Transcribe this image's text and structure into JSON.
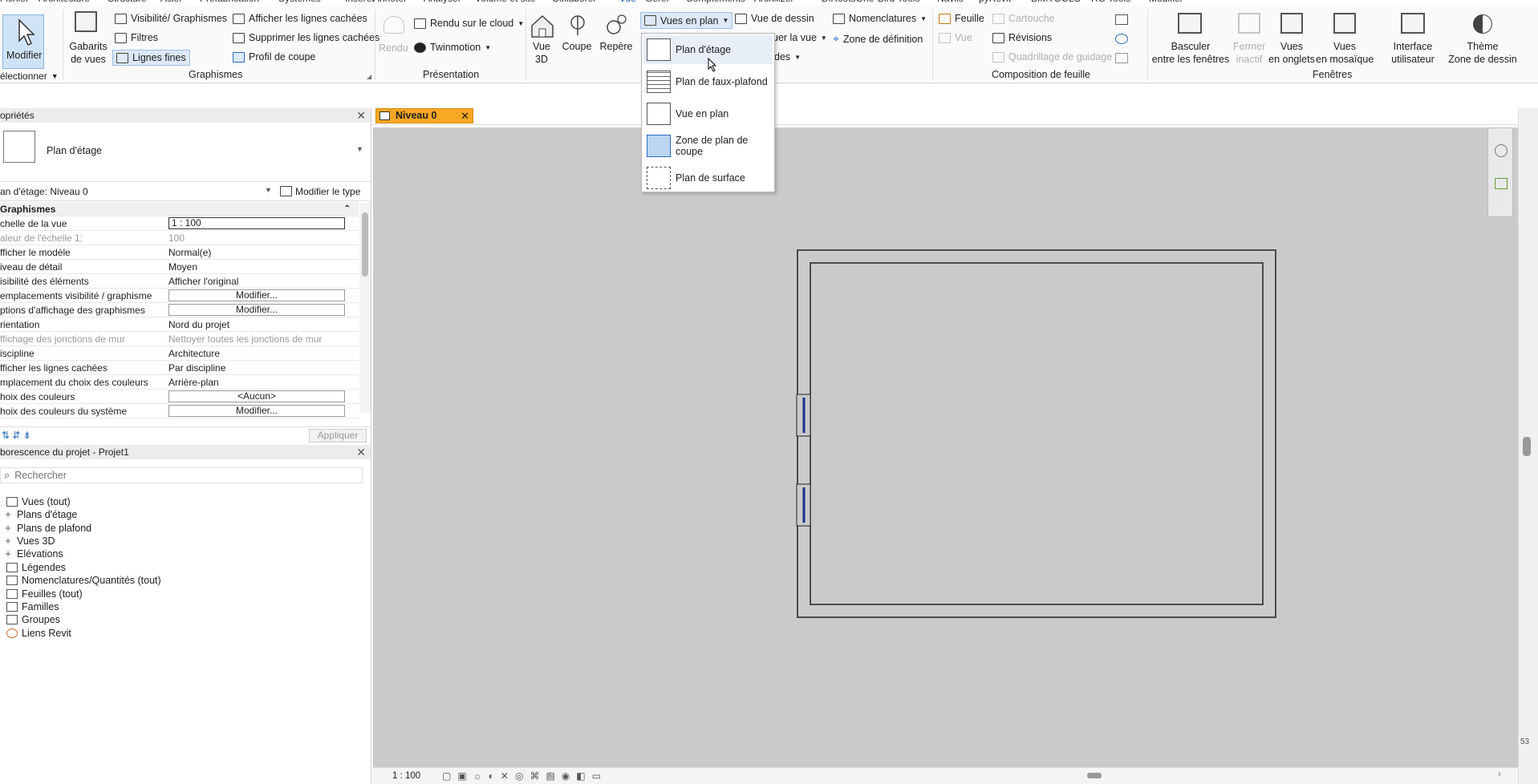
{
  "ribbon_tabs": [
    "Fichier",
    "Architecture",
    "Structure",
    "Acier",
    "Préfabrication",
    "Systèmes",
    "Insérer",
    "Annoter",
    "Analyser",
    "Volume et site",
    "Collaborer",
    "Vue",
    "Gérer",
    "Compléments",
    "Archilizer",
    "DiRootsOne",
    "Bird Tools",
    "Naviis",
    "pyRevit",
    "BIMTOOLS",
    "RG Tools",
    "Modifier"
  ],
  "active_tab": "Vue",
  "ribbon": {
    "modify": "Modifier",
    "select_label": "électionner",
    "view_templates": [
      "Gabarits",
      "de vues"
    ],
    "vis_graphics": "Visibilité/ Graphismes",
    "filters": "Filtres",
    "thin_lines": "Lignes fines",
    "show_hidden": "Afficher les lignes cachées",
    "remove_hidden": "Supprimer les lignes cachées",
    "cut_profile": "Profil de coupe",
    "group_graphics": "Graphismes",
    "render": "Rendu",
    "render_cloud": "Rendu sur le cloud",
    "twinmotion": "Twinmotion",
    "group_presentation": "Présentation",
    "view3d": [
      "Vue",
      "3D"
    ],
    "section": "Coupe",
    "callout": "Repère",
    "plan_views": "Vues en plan",
    "drafting_view": "Vue de dessin",
    "duplicate_partial": "uer la vue",
    "legends_partial": "des",
    "schedules": "Nomenclatures",
    "scope_box": "Zone de définition",
    "sheet": "Feuille",
    "title_block": "Cartouche",
    "view": "Vue",
    "revisions": "Révisions",
    "guide_grid": "Quadrillage de guidage",
    "group_sheet": "Composition de feuille",
    "switch_windows": [
      "Basculer",
      "entre les fenêtres"
    ],
    "close_inactive": [
      "Fermer",
      "inactif"
    ],
    "tab_views": [
      "Vues",
      "en onglets"
    ],
    "tile_views": [
      "Vues",
      "en mosaïque"
    ],
    "user_interface": [
      "Interface",
      "utilisateur"
    ],
    "theme": [
      "Thème",
      "Zone de dessin"
    ],
    "group_windows": "Fenêtres"
  },
  "plan_menu": {
    "items": [
      "Plan d'étage",
      "Plan de faux-plafond",
      "Vue en plan",
      "Zone de plan de coupe",
      "Plan de surface"
    ]
  },
  "properties": {
    "title": "opriétés",
    "type_name": "Plan d'étage",
    "instance_selector": "an d'étage: Niveau 0",
    "edit_type": "Modifier le type",
    "group": "Graphismes",
    "rows": [
      {
        "k": "chelle de la vue",
        "v": "1 : 100",
        "style": "cur"
      },
      {
        "k": "aleur de l'échelle    1:",
        "v": "100",
        "style": "gray"
      },
      {
        "k": "fficher le modèle",
        "v": "Normal(e)",
        "style": ""
      },
      {
        "k": "iveau de détail",
        "v": "Moyen",
        "style": ""
      },
      {
        "k": "isibilité des éléments",
        "v": "Afficher l'original",
        "style": ""
      },
      {
        "k": "emplacements visibilité / graphisme",
        "v": "Modifier...",
        "style": "box"
      },
      {
        "k": "ptions d'affichage des graphismes",
        "v": "Modifier...",
        "style": "box"
      },
      {
        "k": "rientation",
        "v": "Nord du projet",
        "style": ""
      },
      {
        "k": "ffichage des jonctions de mur",
        "v": "Nettoyer toutes les jonctions de mur",
        "style": "gray"
      },
      {
        "k": "iscipline",
        "v": "Architecture",
        "style": ""
      },
      {
        "k": "fficher les lignes cachées",
        "v": "Par discipline",
        "style": ""
      },
      {
        "k": "mplacement du choix des couleurs",
        "v": "Arrière-plan",
        "style": ""
      },
      {
        "k": "hoix des couleurs",
        "v": "<Aucun>",
        "style": "box"
      },
      {
        "k": "hoix des couleurs du système",
        "v": "Modifier...",
        "style": "box"
      }
    ],
    "apply": "Appliquer"
  },
  "browser": {
    "title": "borescence du projet - Projet1",
    "search_placeholder": "Rechercher",
    "items": [
      {
        "label": "Vues (tout)",
        "kind": "root"
      },
      {
        "label": "Plans d'étage",
        "kind": "plus"
      },
      {
        "label": "Plans de plafond",
        "kind": "plus"
      },
      {
        "label": "Vues 3D",
        "kind": "plus"
      },
      {
        "label": "Elévations",
        "kind": "plus"
      },
      {
        "label": "Légendes",
        "kind": "icon"
      },
      {
        "label": "Nomenclatures/Quantités (tout)",
        "kind": "icon"
      },
      {
        "label": "Feuilles (tout)",
        "kind": "icon"
      },
      {
        "label": "Familles",
        "kind": "icon"
      },
      {
        "label": "Groupes",
        "kind": "icon"
      },
      {
        "label": "Liens Revit",
        "kind": "icon"
      }
    ]
  },
  "view_tab": "Niveau 0",
  "status": {
    "scale": "1 : 100",
    "right_number": "53"
  },
  "colors": {
    "accent": "#f9a825",
    "canvas": "#cacaca",
    "selection": "#cfe3f7"
  }
}
